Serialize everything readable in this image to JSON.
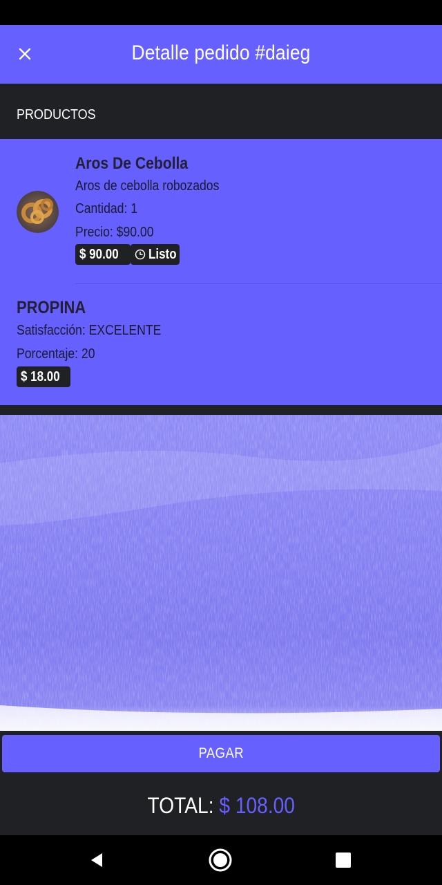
{
  "header": {
    "title": "Detalle pedido #daieg"
  },
  "section": {
    "label": "PRODUCTOS"
  },
  "product": {
    "name": "Aros De Cebolla",
    "description": "Aros de cebolla robozados",
    "quantity": "Cantidad: 1",
    "price": "Precio: $90.00",
    "price_chip": "$  90.00",
    "status_chip": "Listo"
  },
  "tip": {
    "title": "PROPINA",
    "satisfaction": "Satisfacción: EXCELENTE",
    "percentage": "Porcentaje: 20",
    "amount_chip": "$  18.00"
  },
  "actions": {
    "pay_label": "PAGAR"
  },
  "total": {
    "label": "TOTAL: ",
    "value": "$ 108.00"
  },
  "icons": {
    "close": "close-icon",
    "status": "clock-icon",
    "nav_back": "back-triangle-icon",
    "nav_home": "home-circle-icon",
    "nav_recents": "recents-square-icon"
  },
  "colors": {
    "accent": "#6560ff",
    "dark": "#202124",
    "text_dark": "#1b1b2b"
  }
}
